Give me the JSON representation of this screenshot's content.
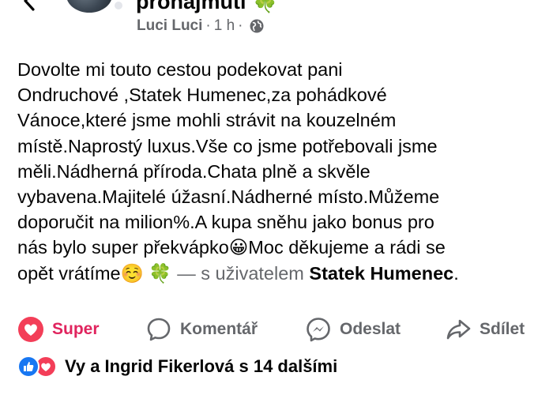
{
  "header": {
    "group_name": "pronajmuti",
    "group_emoji": "🍀",
    "author": "Luci Luci",
    "time": "1 h",
    "separator": "·"
  },
  "post": {
    "lines": [
      "Dovolte mi touto cestou podekovat pani",
      "Ondruchové ,Statek Humenec,za pohádkové",
      "Vánoce,které jsme mohli strávit na kouzelném",
      "místě.Naprostý luxus.Vše co jsme potřebovali jsme",
      "měli.Nádherná příroda.Chata plně a skvěle",
      "vybavena.Majitelé úžasní.Nádherné místo.Můžeme",
      "doporučit na milion%.A kupa sněhu jako bonus pro"
    ],
    "line8_before": "nás bylo super překvápko",
    "line8_emoji": "😀",
    "line8_after": "Moc děkujeme a rádi se",
    "line9_text": "opět vrátíme",
    "line9_emoji": "☺️",
    "line9_emoji2": "🍀",
    "tag_prefix": " — s uživatelem ",
    "tag_name": "Statek Humenec",
    "tag_suffix": "."
  },
  "actions": {
    "super": "Super",
    "comment": "Komentář",
    "send": "Odeslat",
    "share": "Sdílet"
  },
  "reactions": {
    "summary": "Vy a Ingrid Fikerlová s 14 dalšími"
  },
  "colors": {
    "love": "#f33e58",
    "super_text": "#e0245e",
    "like": "#1877f2",
    "secondary": "#65676b"
  }
}
